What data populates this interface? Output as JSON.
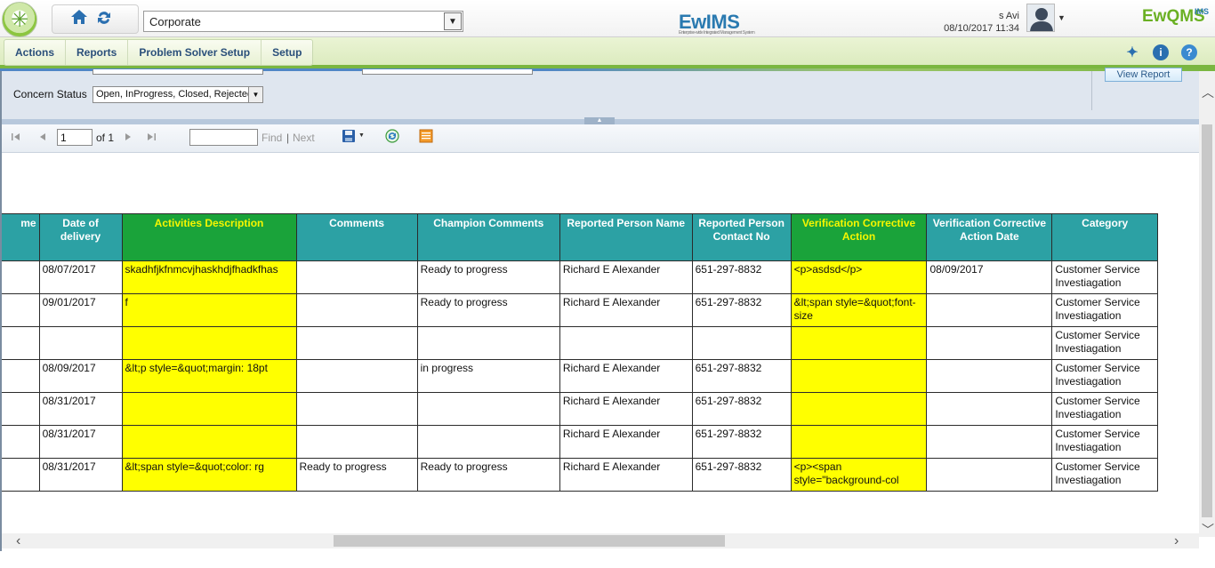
{
  "header": {
    "org_selector": "Corporate",
    "app_logo": "EwIMS",
    "app_logo_tagline": "Enterprise-wide Integrated Management System",
    "user_name": "s Avi",
    "user_datetime": "08/10/2017 11:34",
    "brand_logo": "EwQMS",
    "brand_logo_sup": "IMS"
  },
  "menu": {
    "items": [
      "Actions",
      "Reports",
      "Problem Solver Setup",
      "Setup"
    ],
    "icons": [
      "pin-icon",
      "info-icon",
      "help-icon"
    ]
  },
  "params": {
    "concern_status_label": "Concern Status",
    "concern_status_value": "Open, InProgress, Closed, Rejected",
    "view_report_label": "View Report"
  },
  "toolbar": {
    "page_value": "1",
    "of_label": "of 1",
    "find_label": "Find",
    "separator": "|",
    "next_label": "Next"
  },
  "table": {
    "columns": [
      {
        "label": "me",
        "highlight": false
      },
      {
        "label": "Date of delivery",
        "highlight": false
      },
      {
        "label": "Activities Description",
        "highlight": true
      },
      {
        "label": "Comments",
        "highlight": false
      },
      {
        "label": "Champion Comments",
        "highlight": false
      },
      {
        "label": "Reported Person Name",
        "highlight": false
      },
      {
        "label": "Reported Person Contact No",
        "highlight": false
      },
      {
        "label": "Verification Corrective Action",
        "highlight": true
      },
      {
        "label": "Verification Corrective Action Date",
        "highlight": false
      },
      {
        "label": "Category",
        "highlight": false
      }
    ],
    "rows": [
      [
        "",
        "08/07/2017",
        "skadhfjkfnmcvjhaskhdjfhadkfhas",
        "",
        "Ready to progress",
        "Richard E Alexander",
        "651-297-8832",
        "<p>asdsd</p>",
        "08/09/2017",
        "Customer Service Investiagation"
      ],
      [
        "",
        "09/01/2017",
        "f",
        "",
        "Ready to progress",
        "Richard E Alexander",
        "651-297-8832",
        "&lt;span style=&quot;font-size",
        "",
        "Customer Service Investiagation"
      ],
      [
        "",
        "",
        "",
        "",
        "",
        "",
        "",
        "",
        "",
        "Customer Service Investiagation"
      ],
      [
        "",
        "08/09/2017",
        "&lt;p style=&quot;margin: 18pt",
        "",
        "in progress",
        "Richard E Alexander",
        "651-297-8832",
        "",
        "",
        "Customer Service Investiagation"
      ],
      [
        "",
        "08/31/2017",
        "",
        "",
        "",
        "Richard E Alexander",
        "651-297-8832",
        "",
        "",
        "Customer Service Investiagation"
      ],
      [
        "",
        "08/31/2017",
        "",
        "",
        "",
        "Richard E Alexander",
        "651-297-8832",
        "",
        "",
        "Customer Service Investiagation"
      ],
      [
        "",
        "08/31/2017",
        "&lt;span style=&quot;color: rg",
        "Ready to progress",
        "Ready to progress",
        "Richard E Alexander",
        "651-297-8832",
        "<p><span style=\"background-col",
        "",
        "Customer Service Investiagation"
      ]
    ]
  }
}
